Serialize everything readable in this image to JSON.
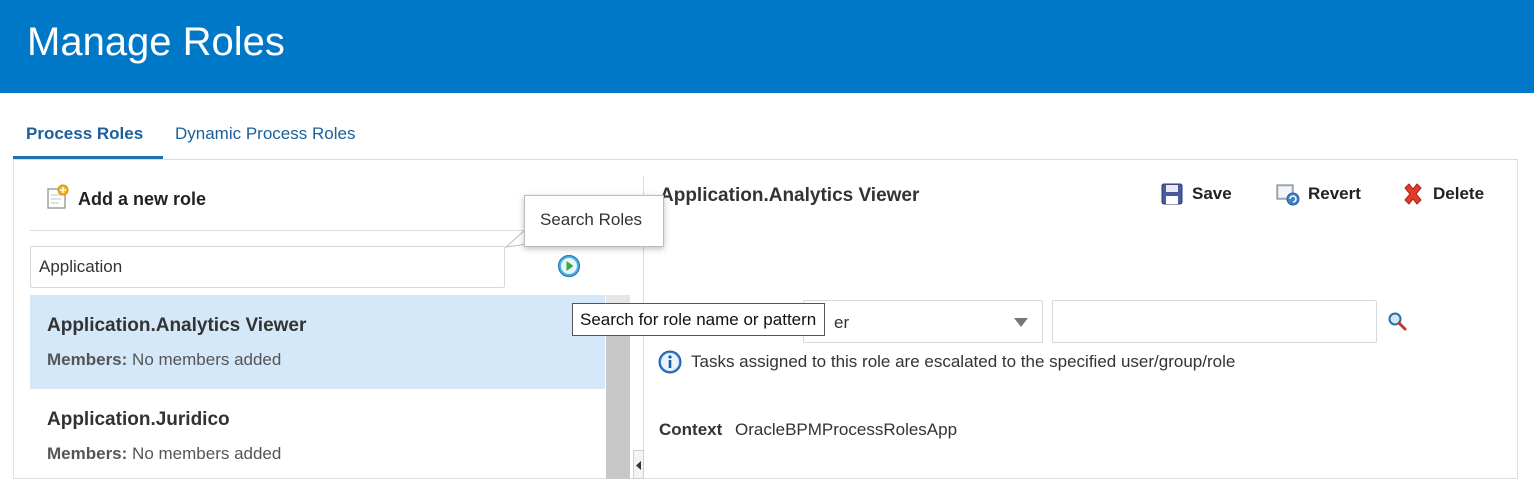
{
  "header": {
    "title": "Manage Roles"
  },
  "tabs": [
    {
      "label": "Process Roles",
      "active": true
    },
    {
      "label": "Dynamic Process Roles",
      "active": false
    }
  ],
  "left_panel": {
    "add_role_label": "Add a new role",
    "search": {
      "value": "Application",
      "tooltip": "Search Roles",
      "go_tooltip": "Search for role name or pattern"
    },
    "roles": [
      {
        "name": "Application.Analytics Viewer",
        "members_label": "Members:",
        "members_value": "No members added",
        "selected": true
      },
      {
        "name": "Application.Juridico",
        "members_label": "Members:",
        "members_value": "No members added",
        "selected": false
      }
    ]
  },
  "right_panel": {
    "role_title": "Application.Analytics Viewer",
    "toolbar": {
      "save_label": "Save",
      "revert_label": "Revert",
      "delete_label": "Delete"
    },
    "escalation": {
      "type_value": "er",
      "info_text": "Tasks assigned to this role are escalated to the specified user/group/role"
    },
    "context": {
      "label": "Context",
      "value": "OracleBPMProcessRolesApp"
    }
  },
  "colors": {
    "header_bg": "#0078c8",
    "tab_active": "#1c5f9b",
    "selected_row": "#d4e8f9"
  }
}
